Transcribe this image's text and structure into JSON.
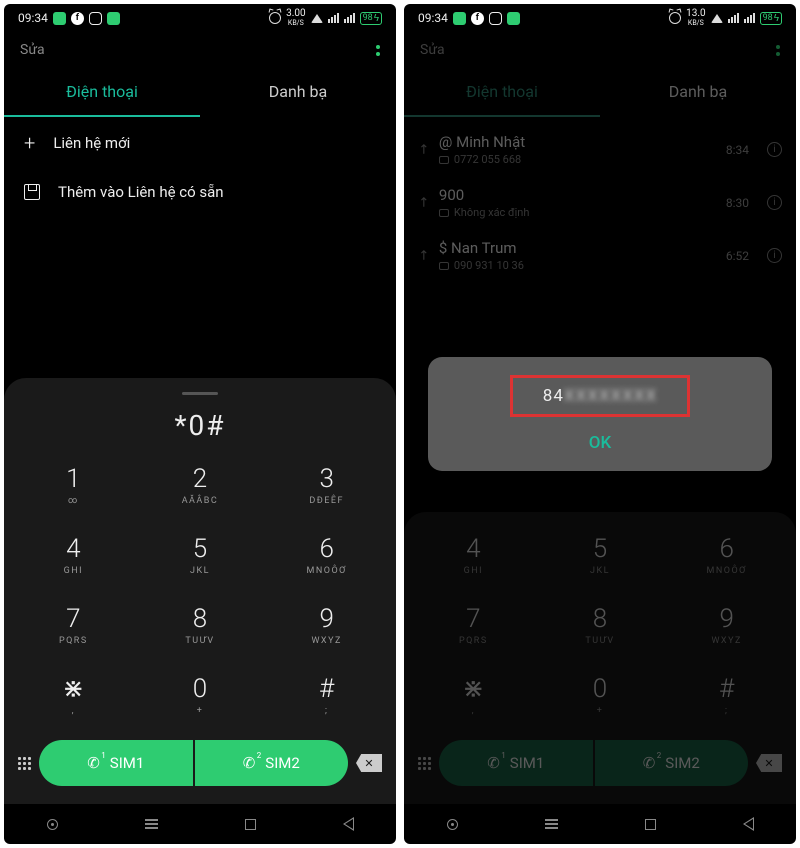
{
  "left": {
    "status": {
      "time": "09:34",
      "speed_num": "3.00",
      "speed_unit": "KB/S",
      "battery": "98"
    },
    "header": {
      "edit": "Sửa"
    },
    "tabs": {
      "phone": "Điện thoại",
      "contacts": "Danh bạ"
    },
    "actions": {
      "new_contact": "Liên hệ mới",
      "add_existing": "Thêm vào Liên hệ có sẵn"
    },
    "dialer": {
      "display": "*0#",
      "keys": [
        {
          "num": "1",
          "sub": "∞"
        },
        {
          "num": "2",
          "sub": "AĂÂBC"
        },
        {
          "num": "3",
          "sub": "DĐEÊF"
        },
        {
          "num": "4",
          "sub": "GHI"
        },
        {
          "num": "5",
          "sub": "JKL"
        },
        {
          "num": "6",
          "sub": "MNOÔƠ"
        },
        {
          "num": "7",
          "sub": "PQRS"
        },
        {
          "num": "8",
          "sub": "TUƯV"
        },
        {
          "num": "9",
          "sub": "WXYZ"
        },
        {
          "num": "⋇",
          "sub": ","
        },
        {
          "num": "0",
          "sub": "+"
        },
        {
          "num": "#",
          "sub": ";"
        }
      ],
      "sim1": "SIM1",
      "sim2": "SIM2"
    }
  },
  "right": {
    "status": {
      "time": "09:34",
      "speed_num": "13.0",
      "speed_unit": "KB/S",
      "battery": "98"
    },
    "header": {
      "edit": "Sửa"
    },
    "tabs": {
      "phone": "Điện thoại",
      "contacts": "Danh bạ"
    },
    "calllog": [
      {
        "name": "@ Minh Nhật",
        "number": "0772 055 668",
        "time": "8:34"
      },
      {
        "name": "900",
        "number": "Không xác định",
        "time": "8:30"
      },
      {
        "name": "$ Nan Trum",
        "number": "090 931 10 36",
        "time": "6:52"
      }
    ],
    "dialer": {
      "keys": [
        {
          "num": "4",
          "sub": "GHI"
        },
        {
          "num": "5",
          "sub": "JKL"
        },
        {
          "num": "6",
          "sub": "MNOÔƠ"
        },
        {
          "num": "7",
          "sub": "PQRS"
        },
        {
          "num": "8",
          "sub": "TUƯV"
        },
        {
          "num": "9",
          "sub": "WXYZ"
        },
        {
          "num": "⋇",
          "sub": ","
        },
        {
          "num": "0",
          "sub": "+"
        },
        {
          "num": "#",
          "sub": ";"
        }
      ],
      "sim1": "SIM1",
      "sim2": "SIM2"
    },
    "dialog": {
      "prefix": "84",
      "hidden": "XXXXXXXX",
      "ok": "OK"
    }
  }
}
